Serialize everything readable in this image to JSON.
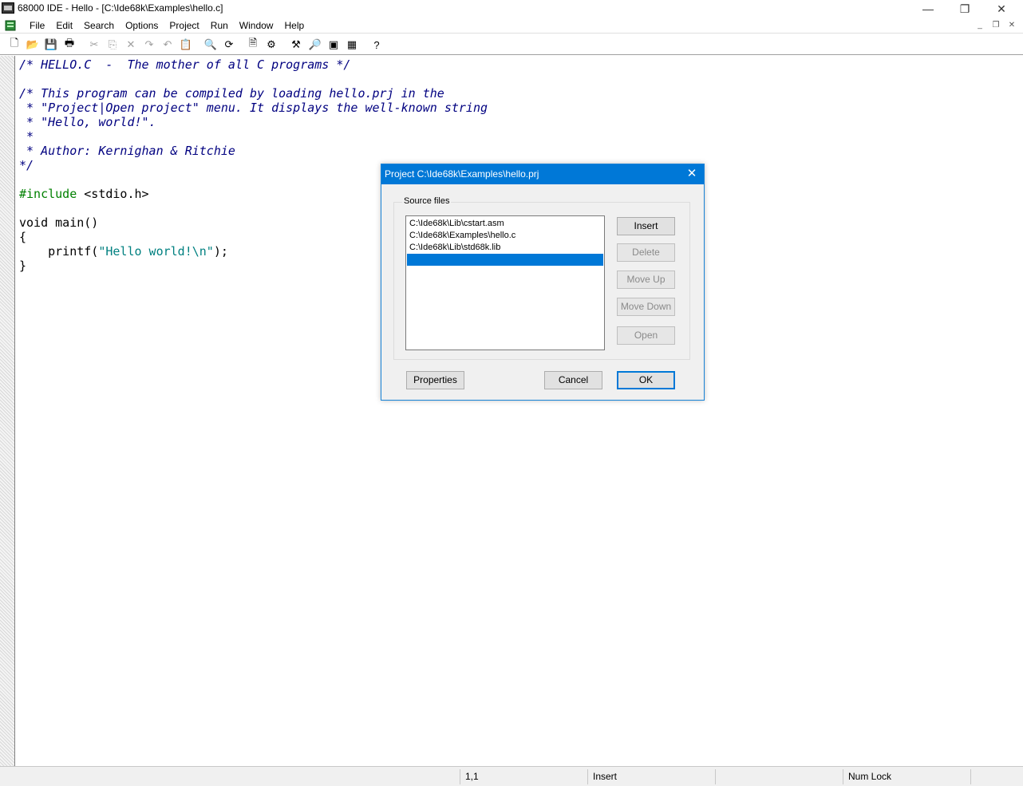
{
  "window": {
    "title": "68000 IDE - Hello - [C:\\Ide68k\\Examples\\hello.c]",
    "min_icon": "—",
    "restore_icon": "❐",
    "close_icon": "✕"
  },
  "menu": {
    "items": [
      "File",
      "Edit",
      "Search",
      "Options",
      "Project",
      "Run",
      "Window",
      "Help"
    ],
    "mdi": {
      "min": "_",
      "restore": "❐",
      "close": "✕"
    }
  },
  "toolbar": {
    "buttons": [
      {
        "name": "new-file-icon",
        "glyph": "🗋",
        "enabled": true
      },
      {
        "name": "open-folder-icon",
        "glyph": "📂",
        "enabled": true
      },
      {
        "name": "save-icon",
        "glyph": "💾",
        "enabled": true
      },
      {
        "name": "print-icon",
        "glyph": "🖶",
        "enabled": true
      },
      {
        "name": "cut-icon",
        "glyph": "✂",
        "enabled": false
      },
      {
        "name": "copy-icon",
        "glyph": "⎘",
        "enabled": false
      },
      {
        "name": "delete-icon",
        "glyph": "✕",
        "enabled": false
      },
      {
        "name": "redo-icon",
        "glyph": "↷",
        "enabled": false
      },
      {
        "name": "undo-icon",
        "glyph": "↶",
        "enabled": false
      },
      {
        "name": "paste-icon",
        "glyph": "📋",
        "enabled": true
      },
      {
        "name": "find-icon",
        "glyph": "🔍",
        "enabled": true
      },
      {
        "name": "replace-icon",
        "glyph": "⟳",
        "enabled": true
      },
      {
        "name": "project-file-icon",
        "glyph": "🗎",
        "enabled": true
      },
      {
        "name": "project-options-icon",
        "glyph": "⚙",
        "enabled": true
      },
      {
        "name": "build-tools-icon",
        "glyph": "⚒",
        "enabled": true
      },
      {
        "name": "debug-search-icon",
        "glyph": "🔎",
        "enabled": true
      },
      {
        "name": "monitor-icon",
        "glyph": "▣",
        "enabled": true
      },
      {
        "name": "chip-icon",
        "glyph": "▦",
        "enabled": true
      },
      {
        "name": "help-icon",
        "glyph": "?",
        "enabled": true
      }
    ]
  },
  "editor": {
    "lines": [
      [
        {
          "t": "comment",
          "s": "/* HELLO.C  -  The mother of all C programs */"
        }
      ],
      [],
      [
        {
          "t": "comment",
          "s": "/* This program can be compiled by loading hello.prj in the"
        }
      ],
      [
        {
          "t": "comment",
          "s": " * \"Project|Open project\" menu. It displays the well-known string"
        }
      ],
      [
        {
          "t": "comment",
          "s": " * \"Hello, world!\"."
        }
      ],
      [
        {
          "t": "comment",
          "s": " *"
        }
      ],
      [
        {
          "t": "comment",
          "s": " * Author: Kernighan & Ritchie"
        }
      ],
      [
        {
          "t": "comment",
          "s": "*/"
        }
      ],
      [],
      [
        {
          "t": "pre",
          "s": "#include"
        },
        {
          "t": "plain",
          "s": " <stdio.h>"
        }
      ],
      [],
      [
        {
          "t": "kw",
          "s": "void"
        },
        {
          "t": "plain",
          "s": " main()"
        }
      ],
      [
        {
          "t": "plain",
          "s": "{"
        }
      ],
      [
        {
          "t": "plain",
          "s": "    printf("
        },
        {
          "t": "str",
          "s": "\"Hello world!\\n\""
        },
        {
          "t": "plain",
          "s": ");"
        }
      ],
      [
        {
          "t": "plain",
          "s": "}"
        }
      ]
    ]
  },
  "statusbar": {
    "position": "1,1",
    "mode": "Insert",
    "numlock": "Num Lock"
  },
  "dialog": {
    "title": "Project C:\\Ide68k\\Examples\\hello.prj",
    "close_icon": "✕",
    "group_label": "Source files",
    "files": [
      "C:\\Ide68k\\Lib\\cstart.asm",
      "C:\\Ide68k\\Examples\\hello.c",
      "C:\\Ide68k\\Lib\\std68k.lib",
      ""
    ],
    "selected_index": 3,
    "buttons": {
      "insert": "Insert",
      "delete": "Delete",
      "move_up": "Move Up",
      "move_down": "Move Down",
      "open": "Open",
      "properties": "Properties",
      "cancel": "Cancel",
      "ok": "OK"
    }
  }
}
